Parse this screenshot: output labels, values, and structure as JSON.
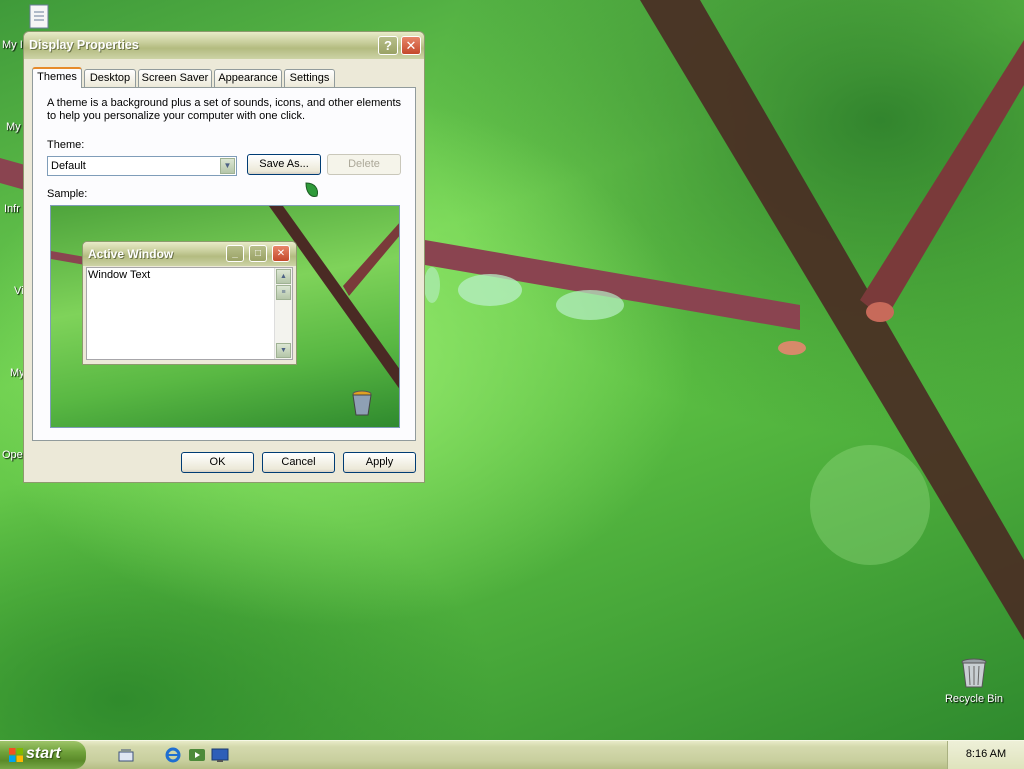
{
  "desktop": {
    "icons": [
      {
        "label": "Recycle Bin"
      }
    ],
    "partial_labels": [
      "My I",
      "My",
      "Infr",
      "Vi",
      "My",
      "Ope"
    ]
  },
  "dialog": {
    "title": "Display Properties",
    "help_glyph": "?",
    "close_glyph": "✕",
    "tabs": [
      {
        "label": "Themes",
        "active": true
      },
      {
        "label": "Desktop",
        "active": false
      },
      {
        "label": "Screen Saver",
        "active": false
      },
      {
        "label": "Appearance",
        "active": false
      },
      {
        "label": "Settings",
        "active": false
      }
    ],
    "description_line1": "A theme is a background plus a set of sounds, icons, and other elements",
    "description_line2": "to help you personalize your computer with one click.",
    "theme_label": "Theme:",
    "theme_value": "Default",
    "save_as_label": "Save As...",
    "delete_label": "Delete",
    "sample_label": "Sample:",
    "sample": {
      "window_title": "Active Window",
      "window_text": "Window Text"
    },
    "ok_label": "OK",
    "cancel_label": "Cancel",
    "apply_label": "Apply"
  },
  "taskbar": {
    "start_label": "start",
    "clock": "8:16 AM",
    "quick_launch": [
      "show-desktop-icon",
      "internet-explorer-icon",
      "media-player-icon",
      "desktop-icon"
    ]
  },
  "colors": {
    "title_bar": "#c7cd9b",
    "start_button": "#6fa13a",
    "active_tab_accent": "#e68b2c"
  }
}
